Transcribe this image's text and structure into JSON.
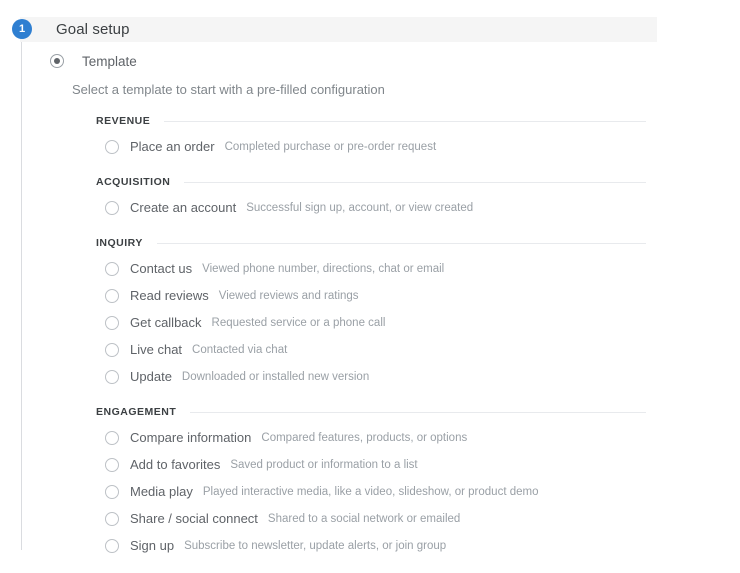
{
  "step": {
    "number": "1",
    "title": "Goal setup"
  },
  "mode": {
    "label": "Template",
    "selected": true,
    "helper": "Select a template to start with a pre-filled configuration"
  },
  "groups": [
    {
      "name": "REVENUE",
      "options": [
        {
          "label": "Place an order",
          "description": "Completed purchase or pre-order request",
          "selected": false
        }
      ]
    },
    {
      "name": "ACQUISITION",
      "options": [
        {
          "label": "Create an account",
          "description": "Successful sign up, account, or view created",
          "selected": false
        }
      ]
    },
    {
      "name": "INQUIRY",
      "options": [
        {
          "label": "Contact us",
          "description": "Viewed phone number, directions, chat or email",
          "selected": false
        },
        {
          "label": "Read reviews",
          "description": "Viewed reviews and ratings",
          "selected": false
        },
        {
          "label": "Get callback",
          "description": "Requested service or a phone call",
          "selected": false
        },
        {
          "label": "Live chat",
          "description": "Contacted via chat",
          "selected": false
        },
        {
          "label": "Update",
          "description": "Downloaded or installed new version",
          "selected": false
        }
      ]
    },
    {
      "name": "ENGAGEMENT",
      "options": [
        {
          "label": "Compare information",
          "description": "Compared features, products, or options",
          "selected": false
        },
        {
          "label": "Add to favorites",
          "description": "Saved product or information to a list",
          "selected": false
        },
        {
          "label": "Media play",
          "description": "Played interactive media, like a video, slideshow, or product demo",
          "selected": false
        },
        {
          "label": "Share / social connect",
          "description": "Shared to a social network or emailed",
          "selected": false
        },
        {
          "label": "Sign up",
          "description": "Subscribe to newsletter, update alerts, or join group",
          "selected": false
        }
      ]
    }
  ],
  "colors": {
    "badge_blue": "#2f7fd1",
    "header_bg": "#f5f5f5",
    "rule": "#e8eaed",
    "text_primary": "#3c4043",
    "text_secondary": "#5f6368",
    "text_muted": "#9aa0a6"
  }
}
